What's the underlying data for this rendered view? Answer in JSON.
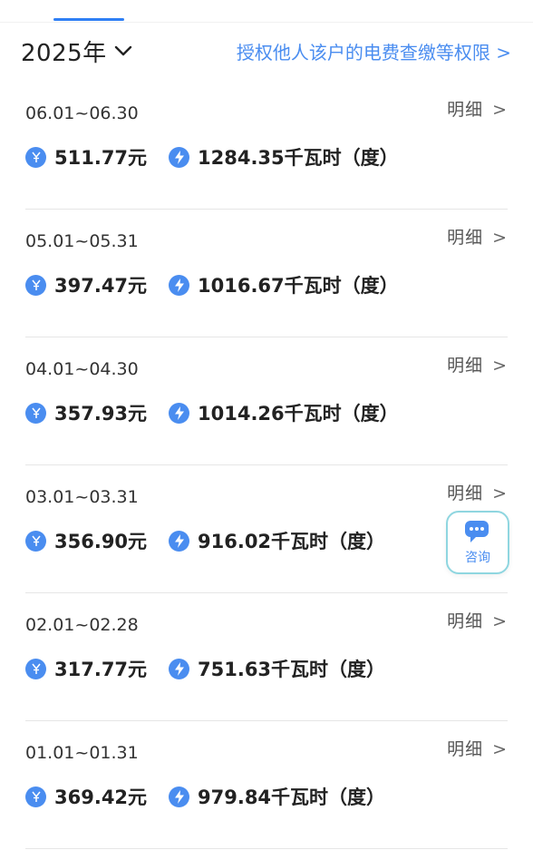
{
  "header": {
    "year": "2025年",
    "authorize_link": "授权他人该户的电费查缴等权限 >"
  },
  "records": [
    {
      "period": "06.01~06.30",
      "detail": "明细",
      "detail_arrow": ">",
      "amount": "511.77元",
      "energy": "1284.35千瓦时（度）"
    },
    {
      "period": "05.01~05.31",
      "detail": "明细",
      "detail_arrow": ">",
      "amount": "397.47元",
      "energy": "1016.67千瓦时（度）"
    },
    {
      "period": "04.01~04.30",
      "detail": "明细",
      "detail_arrow": ">",
      "amount": "357.93元",
      "energy": "1014.26千瓦时（度）"
    },
    {
      "period": "03.01~03.31",
      "detail": "明细",
      "detail_arrow": ">",
      "amount": "356.90元",
      "energy": "916.02千瓦时（度）"
    },
    {
      "period": "02.01~02.28",
      "detail": "明细",
      "detail_arrow": ">",
      "amount": "317.77元",
      "energy": "751.63千瓦时（度）"
    },
    {
      "period": "01.01~01.31",
      "detail": "明细",
      "detail_arrow": ">",
      "amount": "369.42元",
      "energy": "979.84千瓦时（度）"
    }
  ],
  "consult": {
    "label": "咨询"
  },
  "icons": {
    "currency": "yuan-icon",
    "energy": "lightning-icon",
    "consult": "chat-bubble-icon"
  },
  "colors": {
    "accent": "#4a8df0",
    "consult_border": "#8fd6e0"
  }
}
